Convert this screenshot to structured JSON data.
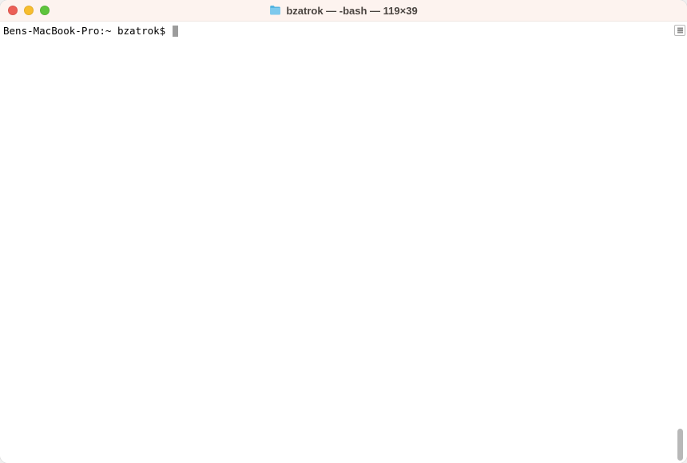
{
  "window": {
    "title": "bzatrok — -bash — 119×39"
  },
  "terminal": {
    "prompt": "Bens-MacBook-Pro:~ bzatrok$ "
  },
  "icons": {
    "folder": "folder-icon"
  }
}
